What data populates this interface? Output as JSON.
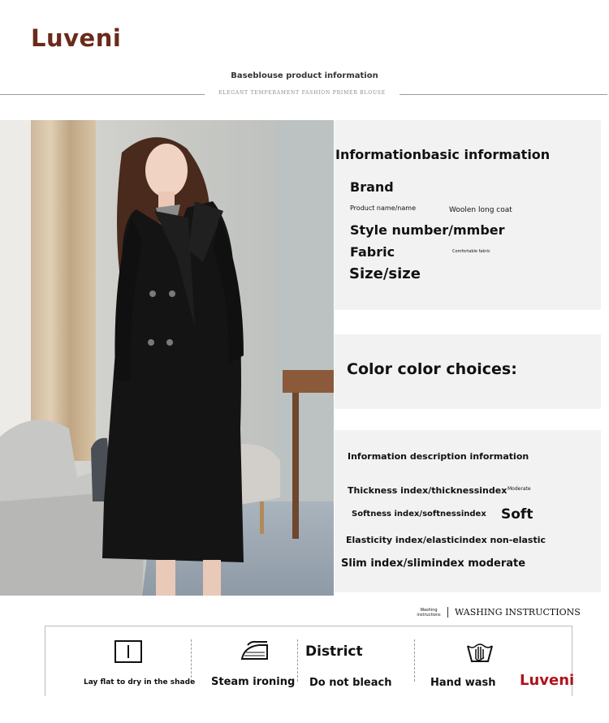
{
  "header": {
    "brand": "Luveni",
    "title": "Baseblouse product information",
    "subtitle": "ELEGANT TEMPERAMENT FASHION PRIMER BLOUSE"
  },
  "basic_info": {
    "heading": "Informationbasic information",
    "brand_label": "Brand",
    "product_name_label": "Product name/name",
    "product_name_value": "Woolen long coat",
    "style_number_label": "Style number/mmber",
    "fabric_label": "Fabric",
    "fabric_value": "Comfortable fabric",
    "size_label": "Size/size"
  },
  "color_info": {
    "heading": "Color color choices:"
  },
  "description": {
    "heading": "Information description information",
    "thickness_label": "Thickness index/thicknessindex",
    "thickness_value": "Moderate",
    "softness_label": "Softness index/softnessindex",
    "softness_value": "Soft",
    "elasticity_text": "Elasticity index/elasticindex non-elastic",
    "slim_text": "Slim index/slimindex moderate"
  },
  "washing": {
    "small_label": "Washing instructions",
    "title": "WASHING INSTRUCTIONS",
    "items": [
      {
        "icon": "lay-flat-icon",
        "label": "Lay flat to dry in the shade"
      },
      {
        "icon": "iron-icon",
        "label": "Steam ironing"
      },
      {
        "icon": "no-bleach",
        "heading": "District",
        "label": "Do not bleach"
      },
      {
        "icon": "hand-wash-icon",
        "label": "Hand wash"
      }
    ],
    "brand": "Luveni"
  },
  "colors": {
    "brand": "#6b2a1a",
    "brand_red": "#b0121b",
    "panel": "#f2f2f2",
    "coat": "#141414"
  }
}
